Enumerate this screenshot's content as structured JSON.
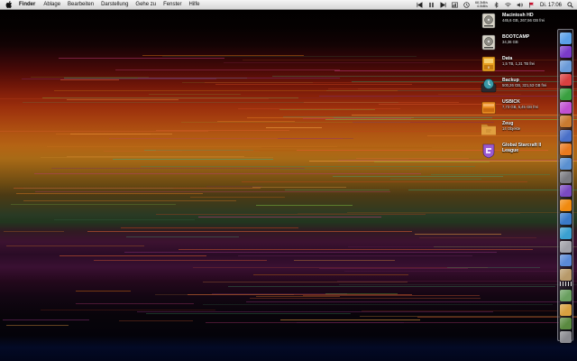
{
  "menubar": {
    "app_name": "Finder",
    "items": [
      "Ablage",
      "Bearbeiten",
      "Darstellung",
      "Gehe zu",
      "Fenster",
      "Hilfe"
    ],
    "net_up": "68.3kB/s",
    "net_down": "4.0kB/s",
    "clock": "Di. 17:06"
  },
  "desktop": {
    "icons": [
      {
        "name": "Macintosh HD",
        "info": "445,6 GB, 267,56 GB frei",
        "icon": "hard-drive-icon",
        "color": "#d8d4c8"
      },
      {
        "name": "BOOTCAMP",
        "info": "34,36 GB",
        "icon": "hard-drive-icon",
        "color": "#d8d4c8"
      },
      {
        "name": "Data",
        "info": "1,5 TB, 1,31 TB frei",
        "icon": "external-drive-icon",
        "color": "#e8a020"
      },
      {
        "name": "Backup",
        "info": "500,26 GB, 321,53 GB frei",
        "icon": "time-machine-drive-icon",
        "color": "#3a9aa8"
      },
      {
        "name": "USBICK",
        "info": "7,73 GB, 5,45 GB frei",
        "icon": "usb-drive-icon",
        "color": "#e88a20"
      },
      {
        "name": "Zeug",
        "info": "14 Objekte",
        "icon": "folder-icon",
        "color": "#e0a040"
      },
      {
        "name": "Global Starcraft II League",
        "info": "",
        "icon": "gsl-app-icon",
        "color": "#9a5ad0"
      }
    ]
  },
  "dock": {
    "items": [
      {
        "name": "finder",
        "color": "#5aa0e8"
      },
      {
        "name": "dashboard",
        "color": "#7a3ac8"
      },
      {
        "name": "mail",
        "color": "#6a9ad8"
      },
      {
        "name": "ical",
        "color": "#d84040"
      },
      {
        "name": "script-editor",
        "color": "#3aa040"
      },
      {
        "name": "itunes",
        "color": "#c050d0"
      },
      {
        "name": "address-book",
        "color": "#c87a30"
      },
      {
        "name": "xcode",
        "color": "#4a70c8"
      },
      {
        "name": "firefox",
        "color": "#e87a20"
      },
      {
        "name": "safari",
        "color": "#5a90d0"
      },
      {
        "name": "network-utility",
        "color": "#7a7a80"
      },
      {
        "name": "imovie",
        "color": "#7a4ac0"
      },
      {
        "name": "vlc",
        "color": "#f08a10"
      },
      {
        "name": "quicktime",
        "color": "#3a7ac8"
      },
      {
        "name": "photo-app",
        "color": "#3aa0d0"
      },
      {
        "name": "utility-app",
        "color": "#a0a0a8"
      },
      {
        "name": "app-store",
        "color": "#5a8ad8"
      },
      {
        "name": "textedit",
        "color": "#b89a6a"
      },
      {
        "name": "downloads-stack",
        "color": "#6aa060"
      },
      {
        "name": "documents-stack",
        "color": "#d8a040"
      },
      {
        "name": "applications-stack",
        "color": "#5a8a40"
      },
      {
        "name": "trash",
        "color": "#8a8a90"
      }
    ]
  }
}
